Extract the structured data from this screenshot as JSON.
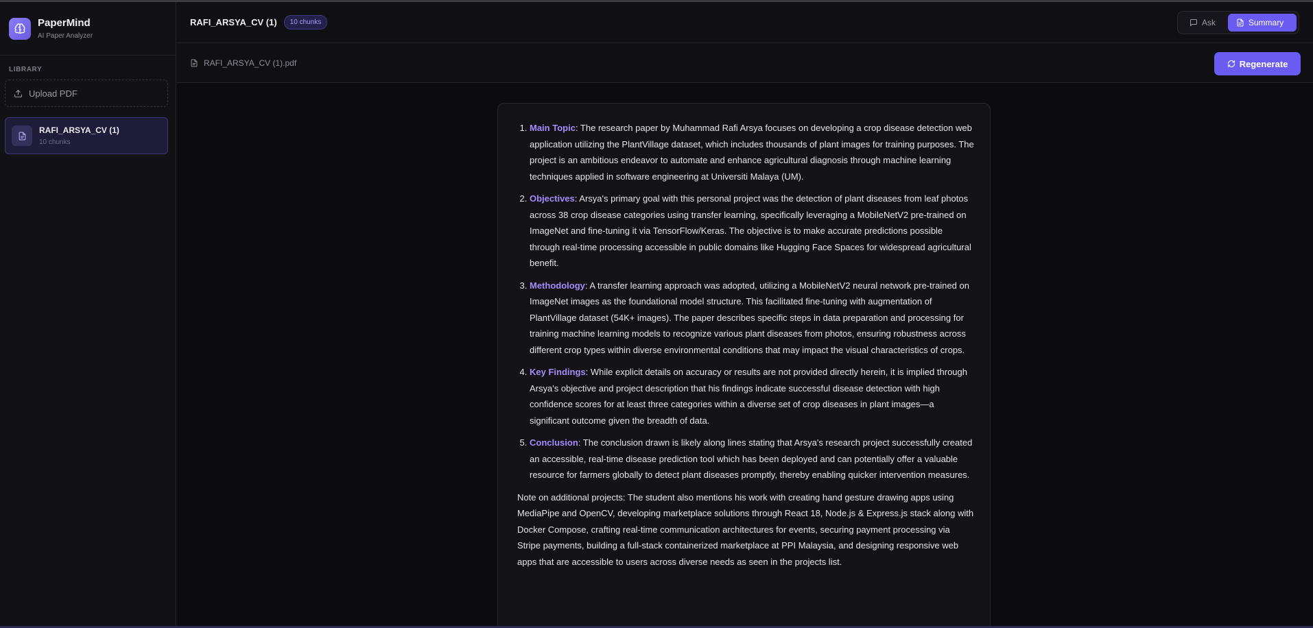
{
  "app": {
    "name": "PaperMind",
    "subtitle": "AI Paper Analyzer"
  },
  "sidebar": {
    "section_label": "LIBRARY",
    "upload_label": "Upload PDF",
    "documents": [
      {
        "name": "RAFI_ARSYA_CV (1)",
        "meta": "10 chunks",
        "active": true
      }
    ]
  },
  "header": {
    "title": "RAFI_ARSYA_CV (1)",
    "badge": "10 chunks",
    "tabs": [
      {
        "label": "Ask",
        "active": false
      },
      {
        "label": "Summary",
        "active": true
      }
    ]
  },
  "subbar": {
    "file_name": "RAFI_ARSYA_CV (1).pdf",
    "regenerate_label": "Regenerate"
  },
  "summary": {
    "items": [
      {
        "key": "Main Topic",
        "text": ": The research paper by Muhammad Rafi Arsya focuses on developing a crop disease detection web application utilizing the PlantVillage dataset, which includes thousands of plant images for training purposes. The project is an ambitious endeavor to automate and enhance agricultural diagnosis through machine learning techniques applied in software engineering at Universiti Malaya (UM)."
      },
      {
        "key": "Objectives",
        "text": ": Arsya's primary goal with this personal project was the detection of plant diseases from leaf photos across 38 crop disease categories using transfer learning, specifically leveraging a MobileNetV2 pre-trained on ImageNet and fine-tuning it via TensorFlow/Keras. The objective is to make accurate predictions possible through real-time processing accessible in public domains like Hugging Face Spaces for widespread agricultural benefit."
      },
      {
        "key": "Methodology",
        "text": ": A transfer learning approach was adopted, utilizing a MobileNetV2 neural network pre-trained on ImageNet images as the foundational model structure. This facilitated fine-tuning with augmentation of PlantVillage dataset (54K+ images). The paper describes specific steps in data preparation and processing for training machine learning models to recognize various plant diseases from photos, ensuring robustness across different crop types within diverse environmental conditions that may impact the visual characteristics of crops."
      },
      {
        "key": "Key Findings",
        "text": ": While explicit details on accuracy or results are not provided directly herein, it is implied through Arsya's objective and project description that his findings indicate successful disease detection with high confidence scores for at least three categories within a diverse set of crop diseases in plant images—a significant outcome given the breadth of data."
      },
      {
        "key": "Conclusion",
        "text": ": The conclusion drawn is likely along lines stating that Arsya's research project successfully created an accessible, real-time disease prediction tool which has been deployed and can potentially offer a valuable resource for farmers globally to detect plant diseases promptly, thereby enabling quicker intervention measures."
      }
    ],
    "note": "Note on additional projects: The student also mentions his work with creating hand gesture drawing apps using MediaPipe and OpenCV, developing marketplace solutions through React 18, Node.js & Express.js stack along with Docker Compose, crafting real-time communication architectures for events, securing payment processing via Stripe payments, building a full-stack containerized marketplace at PPI Malaysia, and designing responsive web apps that are accessible to users across diverse needs as seen in the projects list."
  },
  "colors": {
    "accent": "#6a5cf0",
    "key_text": "#a78bfa",
    "background": "#0c0c10"
  }
}
